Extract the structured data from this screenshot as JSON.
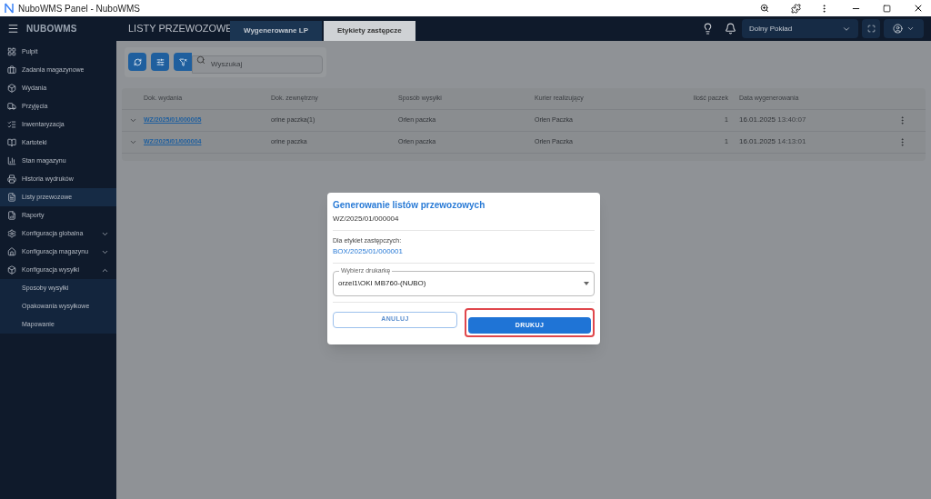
{
  "window": {
    "title": "NuboWMS Panel - NuboWMS"
  },
  "header": {
    "logo": "NUBOWMS",
    "page_title": "LISTY PRZEWOZOWE",
    "tabs": [
      {
        "label": "Wygenerowane LP",
        "selected": false
      },
      {
        "label": "Etykiety zastępcze",
        "selected": true
      }
    ],
    "warehouse": "Dolny Pokład"
  },
  "sidebar": {
    "items": [
      {
        "label": "Pulpit",
        "selected": false
      },
      {
        "label": "Zadania magazynowe",
        "selected": false
      },
      {
        "label": "Wydania",
        "selected": false
      },
      {
        "label": "Przyjęcia",
        "selected": false
      },
      {
        "label": "Inwentaryzacja",
        "selected": false
      },
      {
        "label": "Kartoteki",
        "selected": false
      },
      {
        "label": "Stan magazynu",
        "selected": false
      },
      {
        "label": "Historia wydruków",
        "selected": false
      },
      {
        "label": "Listy przewozowe",
        "selected": true
      },
      {
        "label": "Raporty",
        "selected": false
      },
      {
        "label": "Konfiguracja globalna",
        "selected": false,
        "expanded": false
      },
      {
        "label": "Konfiguracja magazynu",
        "selected": false,
        "expanded": false
      },
      {
        "label": "Konfiguracja wysyłki",
        "selected": false,
        "expanded": true,
        "children": [
          {
            "label": "Sposoby wysyłki"
          },
          {
            "label": "Opakowania wysyłkowe"
          },
          {
            "label": "Mapowanie"
          }
        ]
      }
    ]
  },
  "search": {
    "placeholder": "Wyszukaj"
  },
  "table": {
    "columns": [
      "Dok. wydania",
      "Dok. zewnętrzny",
      "Sposób wysyłki",
      "Kurier realizujący",
      "Ilość paczek",
      "Data wygenerowania"
    ],
    "rows": [
      {
        "doc": "WZ/2025/01/000005",
        "external": "orine paczka(1)",
        "method": "Orlen paczka",
        "courier": "Orlen Paczka",
        "count": "1",
        "date": "16.01.2025",
        "time": "13:40:07"
      },
      {
        "doc": "WZ/2025/01/000004",
        "external": "orine paczka",
        "method": "Orlen paczka",
        "courier": "Orlen Paczka",
        "count": "1",
        "date": "16.01.2025",
        "time": "14:13:01"
      }
    ]
  },
  "dialog": {
    "title": "Generowanie listów przewozowych",
    "subtitle": "WZ/2025/01/000004",
    "label": "Dla etykiet zastępczych:",
    "link": "BOX/2025/01/000001",
    "printer_label": "Wybierz drukarkę",
    "printer_value": "orzel1\\OKI MB760-(NUBO)",
    "buttons": [
      {
        "label": "ANULUJ",
        "kind": "outline"
      },
      {
        "label": "DRUKUJ",
        "kind": "primary"
      }
    ]
  }
}
